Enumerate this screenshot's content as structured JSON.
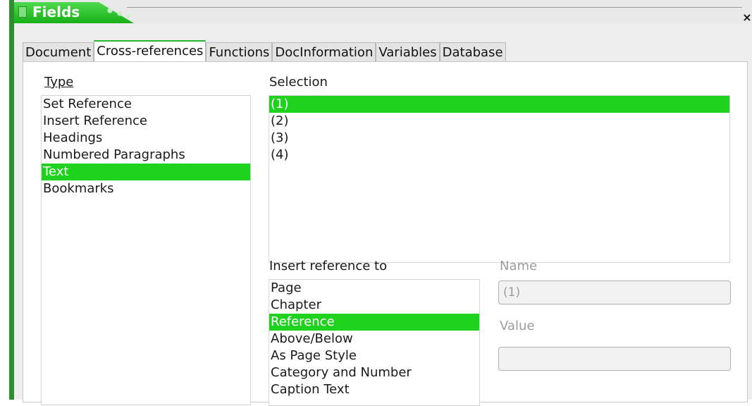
{
  "window": {
    "title": "Fields",
    "close_glyph": "×",
    "accent_color": "#1ed21e"
  },
  "tabs": [
    "Document",
    "Cross-references",
    "Functions",
    "DocInformation",
    "Variables",
    "Database"
  ],
  "active_tab": "Cross-references",
  "type_section": {
    "label": "Type",
    "items": [
      "Set Reference",
      "Insert Reference",
      "Headings",
      "Numbered Paragraphs",
      "Text",
      "Bookmarks"
    ],
    "selected": "Text"
  },
  "selection_section": {
    "label": "Selection",
    "items": [
      "(1)",
      "(2)",
      "(3)",
      "(4)"
    ],
    "selected": "(1)"
  },
  "insert_reference_section": {
    "label": "Insert reference to",
    "items": [
      "Page",
      "Chapter",
      "Reference",
      "Above/Below",
      "As Page Style",
      "Category and Number",
      "Caption Text"
    ],
    "selected": "Reference"
  },
  "name_field": {
    "label": "Name",
    "value": "(1)"
  },
  "value_field": {
    "label": "Value",
    "value": ""
  },
  "icons": {
    "app": "fields-app-icon",
    "close": "close-icon"
  }
}
